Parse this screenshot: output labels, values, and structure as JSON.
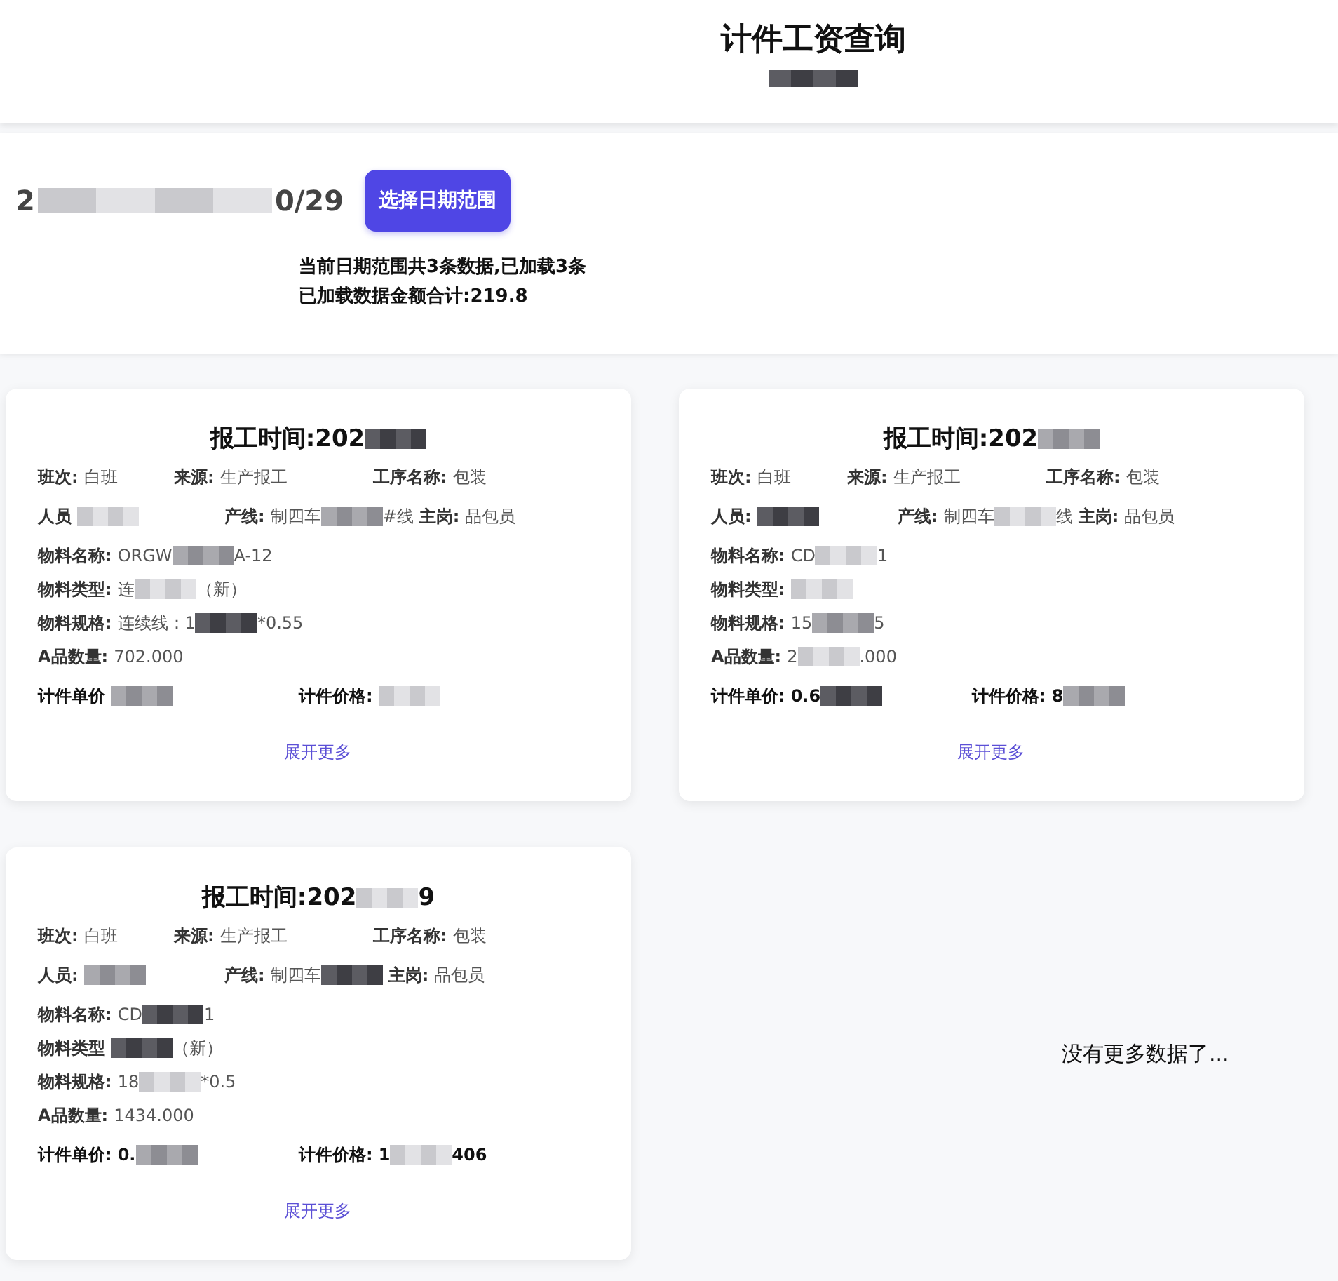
{
  "header": {
    "title": "计件工资查询",
    "subtitle": [
      {
        "kind": "mosaic"
      }
    ]
  },
  "filter": {
    "date_range": [
      {
        "kind": "text",
        "text": "2"
      },
      {
        "kind": "mosaic"
      },
      {
        "kind": "text",
        "text": "0/29"
      }
    ],
    "button": "选择日期范围",
    "summary": [
      "当前日期范围共3条数据,已加载3条",
      "已加载数据金额合计:219.8"
    ]
  },
  "records": [
    {
      "title": [
        {
          "kind": "text",
          "text": "报工时间:202"
        },
        {
          "kind": "mosaic"
        }
      ],
      "shift": {
        "label": "班次:",
        "value": [
          {
            "kind": "text",
            "text": "白班"
          }
        ]
      },
      "source": {
        "label": "来源:",
        "value": [
          {
            "kind": "text",
            "text": "生产报工"
          }
        ]
      },
      "process": {
        "label": "工序名称:",
        "value": [
          {
            "kind": "text",
            "text": "包装"
          }
        ]
      },
      "worker": {
        "label": "人员",
        "value": [
          {
            "kind": "mosaic"
          }
        ]
      },
      "line": {
        "label": "产线:",
        "value": [
          {
            "kind": "text",
            "text": "制四车"
          },
          {
            "kind": "mosaic"
          },
          {
            "kind": "text",
            "text": "#线"
          }
        ]
      },
      "post": {
        "label": "主岗:",
        "value": [
          {
            "kind": "text",
            "text": "品包员"
          }
        ]
      },
      "material_name": {
        "label": "物料名称:",
        "value": [
          {
            "kind": "text",
            "text": "ORGW"
          },
          {
            "kind": "mosaic"
          },
          {
            "kind": "text",
            "text": "A-12"
          }
        ]
      },
      "material_type": {
        "label": "物料类型:",
        "value": [
          {
            "kind": "text",
            "text": "连"
          },
          {
            "kind": "mosaic"
          },
          {
            "kind": "text",
            "text": "（新）"
          }
        ]
      },
      "material_spec": {
        "label": "物料规格:",
        "value": [
          {
            "kind": "text",
            "text": "连续线：1"
          },
          {
            "kind": "mosaic"
          },
          {
            "kind": "text",
            "text": "*0.55"
          }
        ]
      },
      "a_quantity": {
        "label": "A品数量:",
        "value": [
          {
            "kind": "text",
            "text": "702.000"
          }
        ]
      },
      "unit_price": {
        "label": "计件单价",
        "value": [
          {
            "kind": "mosaic"
          }
        ]
      },
      "piece_price": {
        "label": "计件价格:",
        "value": [
          {
            "kind": "mosaic"
          }
        ]
      },
      "expand_link": "展开更多"
    },
    {
      "title": [
        {
          "kind": "text",
          "text": "报工时间:202"
        },
        {
          "kind": "mosaic"
        }
      ],
      "shift": {
        "label": "班次:",
        "value": [
          {
            "kind": "text",
            "text": "白班"
          }
        ]
      },
      "source": {
        "label": "来源:",
        "value": [
          {
            "kind": "text",
            "text": "生产报工"
          }
        ]
      },
      "process": {
        "label": "工序名称:",
        "value": [
          {
            "kind": "text",
            "text": "包装"
          }
        ]
      },
      "worker": {
        "label": "人员:",
        "value": [
          {
            "kind": "mosaic"
          }
        ]
      },
      "line": {
        "label": "产线:",
        "value": [
          {
            "kind": "text",
            "text": "制四车"
          },
          {
            "kind": "mosaic"
          },
          {
            "kind": "text",
            "text": "线"
          }
        ]
      },
      "post": {
        "label": "主岗:",
        "value": [
          {
            "kind": "text",
            "text": "品包员"
          }
        ]
      },
      "material_name": {
        "label": "物料名称:",
        "value": [
          {
            "kind": "text",
            "text": "CD"
          },
          {
            "kind": "mosaic"
          },
          {
            "kind": "text",
            "text": "1"
          }
        ]
      },
      "material_type": {
        "label": "物料类型:",
        "value": [
          {
            "kind": "mosaic"
          }
        ]
      },
      "material_spec": {
        "label": "物料规格:",
        "value": [
          {
            "kind": "text",
            "text": "15"
          },
          {
            "kind": "mosaic"
          },
          {
            "kind": "text",
            "text": "5"
          }
        ]
      },
      "a_quantity": {
        "label": "A品数量:",
        "value": [
          {
            "kind": "text",
            "text": "2"
          },
          {
            "kind": "mosaic"
          },
          {
            "kind": "text",
            "text": ".000"
          }
        ]
      },
      "unit_price": {
        "label": "计件单价:",
        "value": [
          {
            "kind": "text",
            "text": "0.6"
          },
          {
            "kind": "mosaic"
          }
        ]
      },
      "piece_price": {
        "label": "计件价格:",
        "value": [
          {
            "kind": "text",
            "text": "8"
          },
          {
            "kind": "mosaic"
          }
        ]
      },
      "expand_link": "展开更多"
    },
    {
      "title": [
        {
          "kind": "text",
          "text": "报工时间:202"
        },
        {
          "kind": "mosaic"
        },
        {
          "kind": "text",
          "text": "9"
        }
      ],
      "shift": {
        "label": "班次:",
        "value": [
          {
            "kind": "text",
            "text": "白班"
          }
        ]
      },
      "source": {
        "label": "来源:",
        "value": [
          {
            "kind": "text",
            "text": "生产报工"
          }
        ]
      },
      "process": {
        "label": "工序名称:",
        "value": [
          {
            "kind": "text",
            "text": "包装"
          }
        ]
      },
      "worker": {
        "label": "人员:",
        "value": [
          {
            "kind": "mosaic"
          }
        ]
      },
      "line": {
        "label": "产线:",
        "value": [
          {
            "kind": "text",
            "text": "制四车"
          },
          {
            "kind": "mosaic"
          }
        ]
      },
      "post": {
        "label": "主岗:",
        "value": [
          {
            "kind": "text",
            "text": "品包员"
          }
        ]
      },
      "material_name": {
        "label": "物料名称:",
        "value": [
          {
            "kind": "text",
            "text": "CD"
          },
          {
            "kind": "mosaic"
          },
          {
            "kind": "text",
            "text": "1"
          }
        ]
      },
      "material_type": {
        "label": "物料类型",
        "value": [
          {
            "kind": "mosaic"
          },
          {
            "kind": "text",
            "text": "（新）"
          }
        ]
      },
      "material_spec": {
        "label": "物料规格:",
        "value": [
          {
            "kind": "text",
            "text": "18"
          },
          {
            "kind": "mosaic"
          },
          {
            "kind": "text",
            "text": "*0.5"
          }
        ]
      },
      "a_quantity": {
        "label": "A品数量:",
        "value": [
          {
            "kind": "text",
            "text": "1434.000"
          }
        ]
      },
      "unit_price": {
        "label": "计件单价:",
        "value": [
          {
            "kind": "text",
            "text": "0."
          },
          {
            "kind": "mosaic"
          }
        ]
      },
      "piece_price": {
        "label": "计件价格:",
        "value": [
          {
            "kind": "text",
            "text": "1"
          },
          {
            "kind": "mosaic"
          },
          {
            "kind": "text",
            "text": "406"
          }
        ]
      },
      "expand_link": "展开更多"
    }
  ],
  "end_message": "没有更多数据了..."
}
